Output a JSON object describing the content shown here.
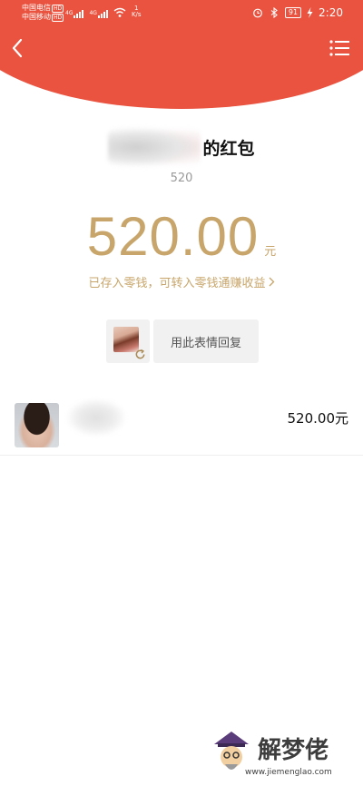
{
  "status_bar": {
    "carrier_1": "中国电信",
    "carrier_2": "中国移动",
    "hd_label": "HD",
    "net_1": "4G",
    "net_2": "4G",
    "speed_value": "1",
    "speed_unit": "K/s",
    "battery": "91",
    "time": "2:20"
  },
  "header": {
    "accent_color": "#e9533f",
    "back_icon": "chevron-left-icon",
    "menu_icon": "list-menu-icon"
  },
  "red_packet": {
    "title_suffix": "的红包",
    "greeting": "520",
    "amount": "520.00",
    "unit": "元",
    "saved_note": "已存入零钱，可转入零钱通赚收益",
    "amount_color": "#c8a56a"
  },
  "sticker_reply": {
    "reply_label": "用此表情回复",
    "refresh_icon": "refresh-icon"
  },
  "records": [
    {
      "amount": "520.00元"
    }
  ],
  "watermark": {
    "name": "解梦佬",
    "url": "www.jiemenglao.com"
  }
}
